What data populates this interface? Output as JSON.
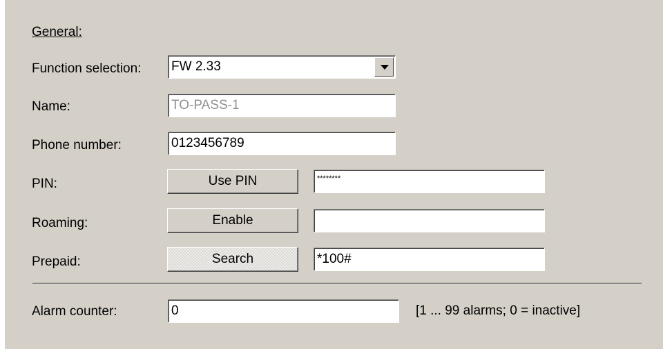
{
  "general": {
    "section_label": "General:",
    "function_selection": {
      "label": "Function selection:",
      "value": "FW 2.33"
    },
    "name": {
      "label": "Name:",
      "value": "TO-PASS-1"
    },
    "phone_number": {
      "label": "Phone number:",
      "value": "0123456789"
    },
    "pin": {
      "label": "PIN:",
      "button_label": "Use PIN",
      "value": "********"
    },
    "roaming": {
      "label": "Roaming:",
      "button_label": "Enable",
      "value": ""
    },
    "prepaid": {
      "label": "Prepaid:",
      "button_label": "Search",
      "value": "*100#"
    }
  },
  "alarm_counter": {
    "label": "Alarm counter:",
    "value": "0",
    "hint": "[1 ... 99 alarms; 0 = inactive]"
  },
  "colors": {
    "panel_bg": "#d4d0c8",
    "field_bg": "#ffffff",
    "disabled_text": "#909090"
  }
}
